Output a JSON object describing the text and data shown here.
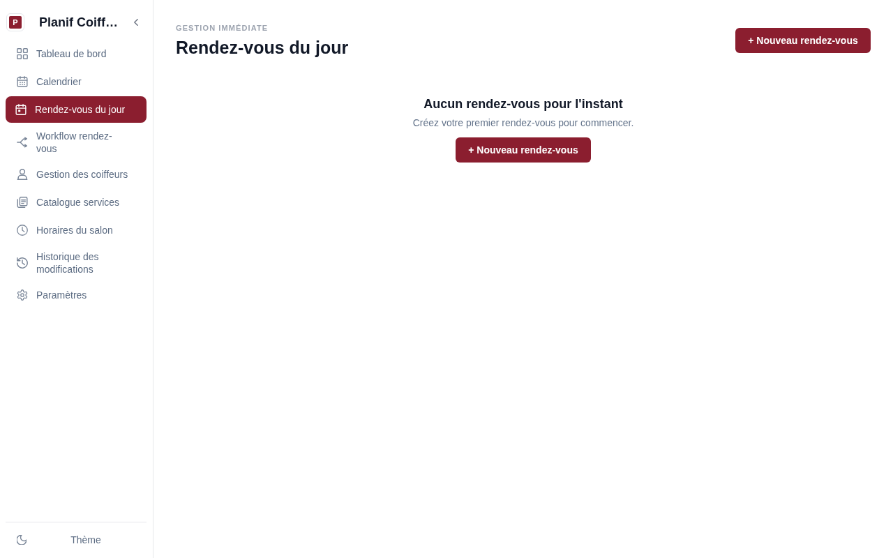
{
  "sidebar": {
    "logo_letter": "P",
    "app_name": "Planif Coiff…",
    "items": [
      {
        "label": "Tableau de bord",
        "selected": false
      },
      {
        "label": "Calendrier",
        "selected": false
      },
      {
        "label": "Rendez-vous du jour",
        "selected": true
      },
      {
        "label": "Workflow rendez-vous",
        "selected": false
      },
      {
        "label": "Gestion des coiffeurs",
        "selected": false
      },
      {
        "label": "Catalogue services",
        "selected": false
      },
      {
        "label": "Horaires du salon",
        "selected": false
      },
      {
        "label": "Historique des modifications",
        "selected": false
      },
      {
        "label": "Paramètres",
        "selected": false
      }
    ],
    "footer": {
      "theme_label": "Thème"
    }
  },
  "header": {
    "eyebrow": "GESTION IMMÉDIATE",
    "title": "Rendez-vous du jour",
    "new_button": "+ Nouveau rendez-vous"
  },
  "empty_state": {
    "title": "Aucun rendez-vous pour l'instant",
    "message": "Créez votre premier rendez-vous pour commencer.",
    "button": "+ Nouveau rendez-vous"
  }
}
